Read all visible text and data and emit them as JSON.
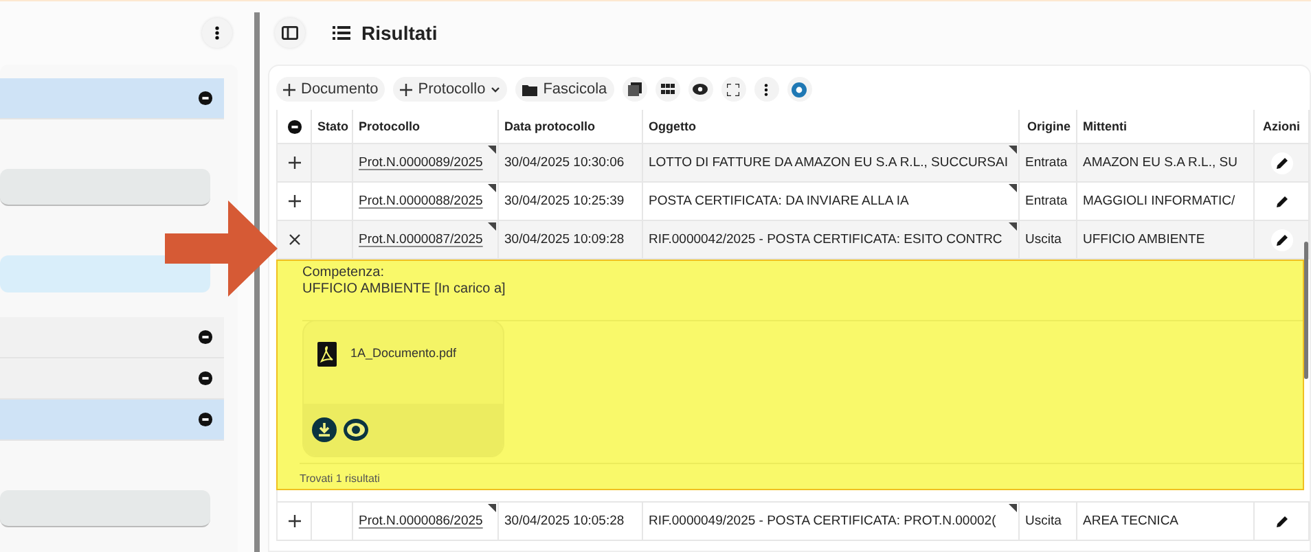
{
  "left_panel": {
    "items": [
      {
        "kind": "row",
        "selected": true
      },
      {
        "kind": "field",
        "selected": false
      },
      {
        "kind": "field",
        "selected": true
      },
      {
        "kind": "row",
        "selected": false
      },
      {
        "kind": "row",
        "selected": false
      },
      {
        "kind": "row",
        "selected": true
      },
      {
        "kind": "field",
        "selected": false
      }
    ]
  },
  "header": {
    "title": "Risultati"
  },
  "toolbar": {
    "buttons": [
      {
        "label": "Documento",
        "kind": "add"
      },
      {
        "label": "Protocollo",
        "kind": "add-menu"
      },
      {
        "label": "Fascicola",
        "kind": "folder"
      }
    ]
  },
  "table": {
    "columns": [
      "Stato",
      "Protocollo",
      "Data protocollo",
      "Oggetto",
      "Origine",
      "Mittenti",
      "Azioni"
    ],
    "rows": [
      {
        "expanded": false,
        "protocollo": "Prot.N.0000089/2025",
        "data": "30/04/2025 10:30:06",
        "oggetto": "LOTTO DI FATTURE DA AMAZON EU S.A R.L., SUCCURSAI",
        "origine": "Entrata",
        "mittenti": "AMAZON EU S.A R.L., SU"
      },
      {
        "expanded": false,
        "protocollo": "Prot.N.0000088/2025",
        "data": "30/04/2025 10:25:39",
        "oggetto": "POSTA CERTIFICATA: DA INVIARE ALLA IA",
        "origine": "Entrata",
        "mittenti": "MAGGIOLI INFORMATIC/"
      },
      {
        "expanded": true,
        "protocollo": "Prot.N.0000087/2025",
        "data": "30/04/2025 10:09:28",
        "oggetto": "RIF.0000042/2025 - POSTA CERTIFICATA: ESITO CONTRC",
        "origine": "Uscita",
        "mittenti": "UFFICIO AMBIENTE",
        "detail": {
          "label": "Competenza:",
          "value": "UFFICIO AMBIENTE [In carico a]",
          "file": "1A_Documento.pdf",
          "footer": "Trovati 1 risultati"
        }
      },
      {
        "expanded": false,
        "protocollo": "Prot.N.0000086/2025",
        "data": "30/04/2025 10:05:28",
        "oggetto": "RIF.0000049/2025 - POSTA CERTIFICATA: PROT.N.00002(",
        "origine": "Uscita",
        "mittenti": "AREA TECNICA"
      }
    ]
  }
}
